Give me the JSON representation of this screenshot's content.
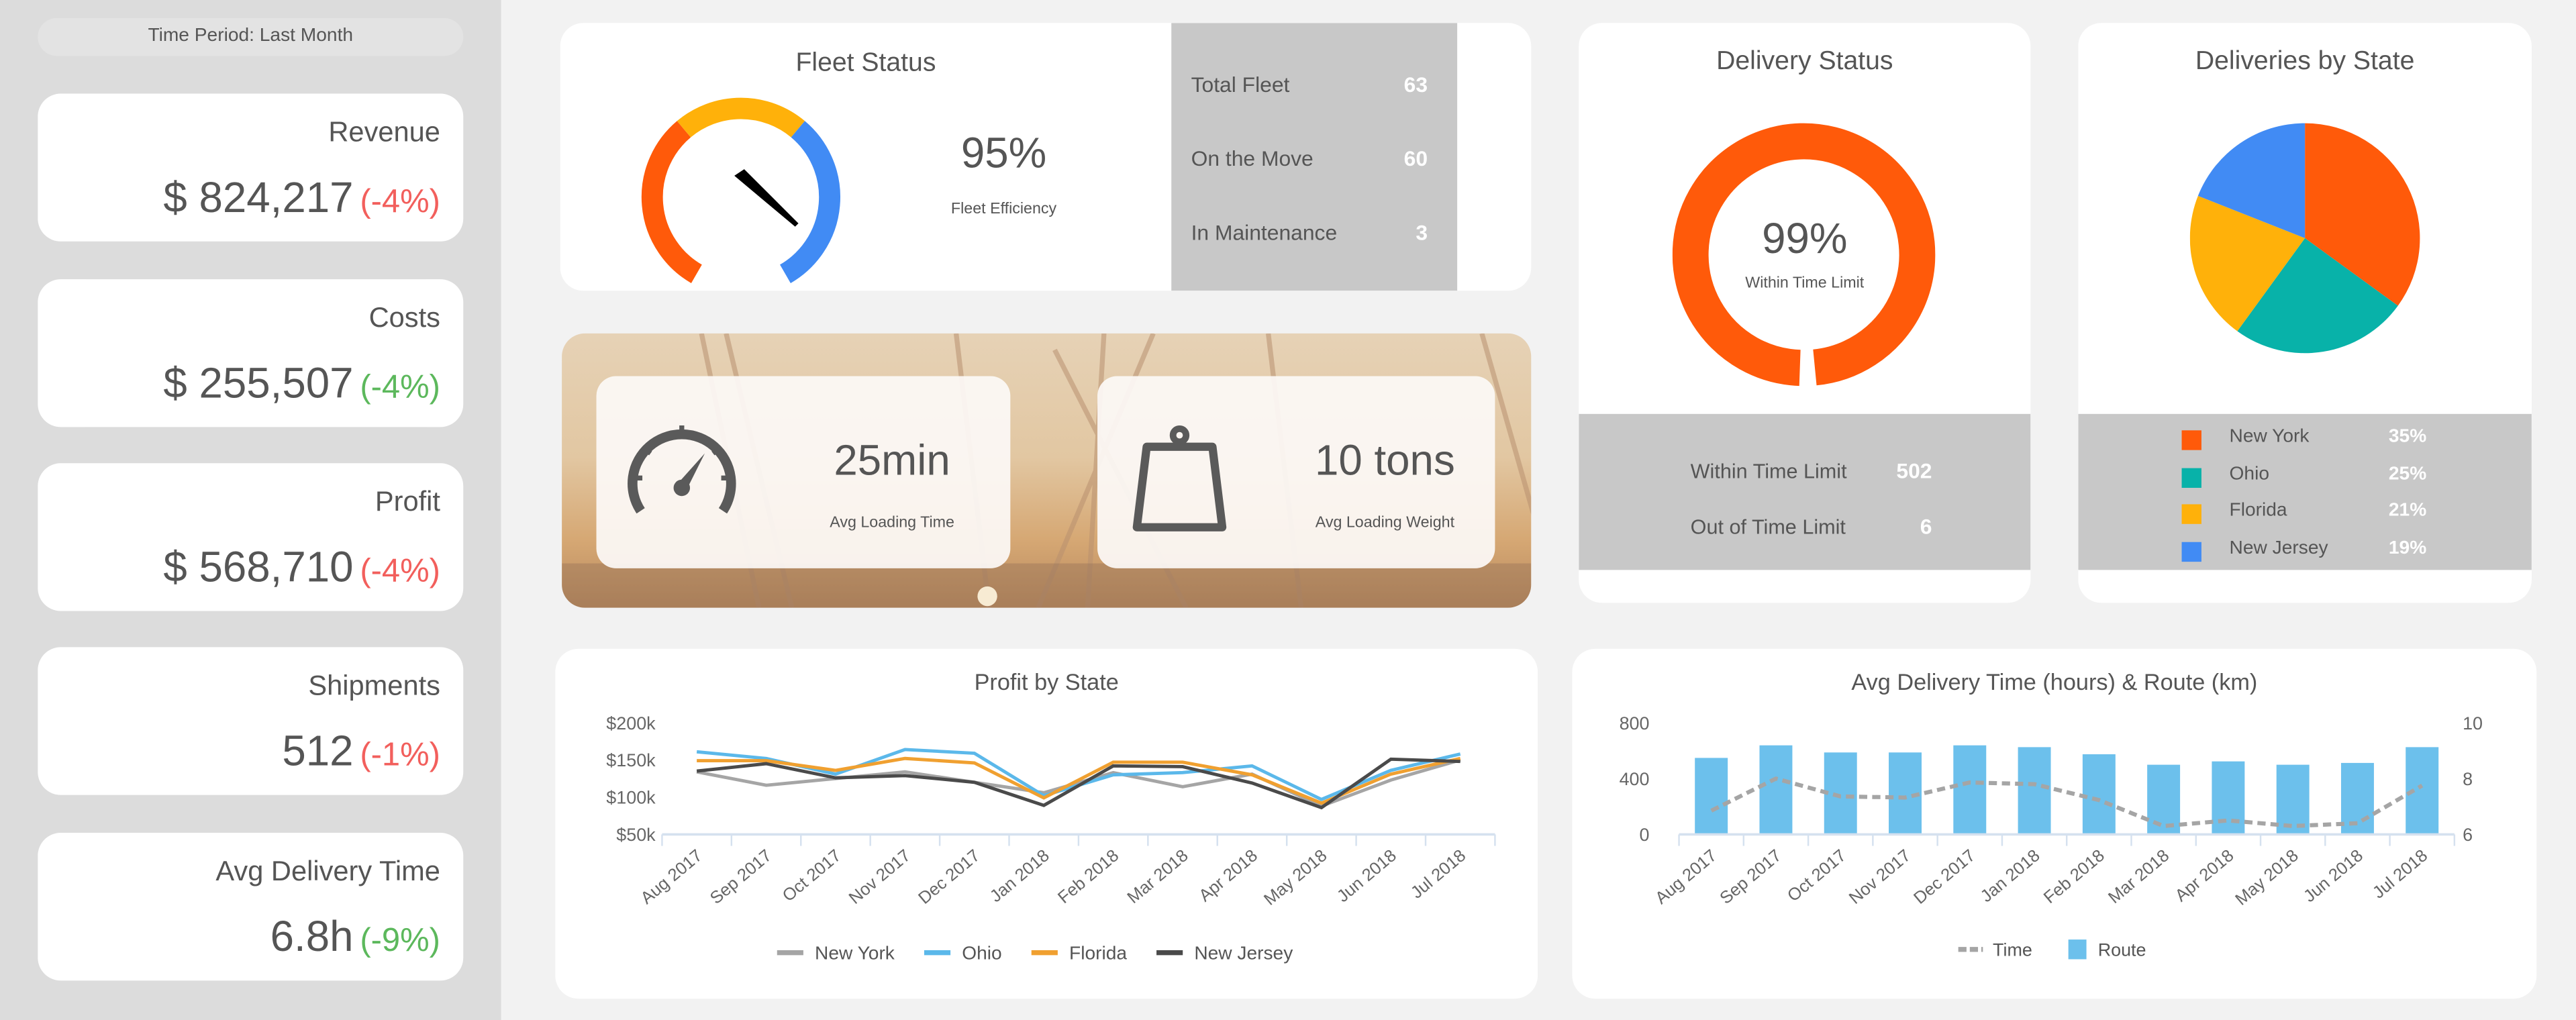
{
  "sidebar": {
    "time_period": "Time Period: Last Month",
    "kpis": [
      {
        "label": "Revenue",
        "value": "$ 824,217",
        "change": "(-4%)",
        "change_color": "#f25f5c"
      },
      {
        "label": "Costs",
        "value": "$ 255,507",
        "change": "(-4%)",
        "change_color": "#5cb85c"
      },
      {
        "label": "Profit",
        "value": "$ 568,710",
        "change": "(-4%)",
        "change_color": "#f25f5c"
      },
      {
        "label": "Shipments",
        "value": "512",
        "change": "(-1%)",
        "change_color": "#f25f5c"
      },
      {
        "label": "Avg Delivery Time",
        "value": "6.8h",
        "change": "(-9%)",
        "change_color": "#5cb85c"
      }
    ]
  },
  "fleet": {
    "title": "Fleet Status",
    "efficiency": "95%",
    "efficiency_label": "Fleet Efficiency",
    "gauge_colors": [
      "#ff5a0a",
      "#ffb10a",
      "#418bf4"
    ],
    "stats": [
      {
        "label": "Total Fleet",
        "value": "63"
      },
      {
        "label": "On the Move",
        "value": "60"
      },
      {
        "label": "In Maintenance",
        "value": "3"
      }
    ]
  },
  "loading": {
    "time": {
      "value": "25min",
      "label": "Avg Loading Time",
      "icon": "speedometer-icon"
    },
    "weight": {
      "value": "10 tons",
      "label": "Avg Loading Weight",
      "icon": "weight-icon"
    }
  },
  "delivery_status": {
    "title": "Delivery Status",
    "percent": "99%",
    "percent_value": 99,
    "percent_label": "Within Time Limit",
    "color": "#ff5a0a",
    "rows": [
      {
        "label": "Within Time Limit",
        "value": "502"
      },
      {
        "label": "Out of Time Limit",
        "value": "6"
      }
    ]
  },
  "chart_data": [
    {
      "type": "pie",
      "title": "Deliveries by State",
      "categories": [
        "New York",
        "Ohio",
        "Florida",
        "New Jersey"
      ],
      "values": [
        35,
        25,
        21,
        19
      ],
      "labels": [
        "35%",
        "25%",
        "21%",
        "19%"
      ],
      "colors": [
        "#ff5a0a",
        "#08b2a9",
        "#ffb10a",
        "#418bf4"
      ]
    },
    {
      "type": "line",
      "title": "Profit by State",
      "categories": [
        "Aug 2017",
        "Sep 2017",
        "Oct 2017",
        "Nov 2017",
        "Dec 2017",
        "Jan 2018",
        "Feb 2018",
        "Mar 2018",
        "Apr 2018",
        "May 2018",
        "Jun 2018",
        "Jul 2018"
      ],
      "yticks": [
        "$50k",
        "$100k",
        "$150k",
        "$200k"
      ],
      "ylim": [
        50,
        200
      ],
      "legend": "bottom",
      "series": [
        {
          "name": "New York",
          "color": "#a5a5a5",
          "values": [
            134,
            116,
            125,
            134,
            120,
            106,
            133,
            114,
            131,
            88,
            123,
            150
          ]
        },
        {
          "name": "Ohio",
          "color": "#5bb8ea",
          "values": [
            161,
            152,
            131,
            164,
            159,
            102,
            130,
            133,
            142,
            97,
            136,
            158
          ]
        },
        {
          "name": "Florida",
          "color": "#f0a030",
          "values": [
            149,
            149,
            136,
            152,
            146,
            99,
            147,
            147,
            130,
            92,
            131,
            152
          ]
        },
        {
          "name": "New Jersey",
          "color": "#4a4a4a",
          "values": [
            135,
            145,
            126,
            129,
            120,
            89,
            142,
            141,
            119,
            86,
            151,
            148
          ]
        }
      ]
    },
    {
      "type": "bar+line",
      "title": "Avg Delivery Time (hours) & Route (km)",
      "categories": [
        "Aug 2017",
        "Sep 2017",
        "Oct 2017",
        "Nov 2017",
        "Dec 2017",
        "Jan 2018",
        "Feb 2018",
        "Mar 2018",
        "Apr 2018",
        "May 2018",
        "Jun 2018",
        "Jul 2018"
      ],
      "yticks_left": [
        "0",
        "400",
        "800"
      ],
      "ylim_left": [
        0,
        800
      ],
      "yticks_right": [
        "6",
        "8",
        "10"
      ],
      "ylim_right": [
        6,
        10
      ],
      "legend": "bottom",
      "series": [
        {
          "name": "Time",
          "type": "line",
          "style": "dashed",
          "axis": "right",
          "color": "#a5a5a5",
          "values": [
            6.85,
            8.0,
            7.36,
            7.32,
            7.86,
            7.8,
            7.23,
            6.3,
            6.5,
            6.3,
            6.4,
            7.75
          ]
        },
        {
          "name": "Route",
          "type": "bar",
          "axis": "left",
          "color": "#6cc0ec",
          "values": [
            548,
            638,
            587,
            587,
            638,
            625,
            574,
            499,
            523,
            499,
            512,
            625
          ]
        }
      ]
    }
  ]
}
